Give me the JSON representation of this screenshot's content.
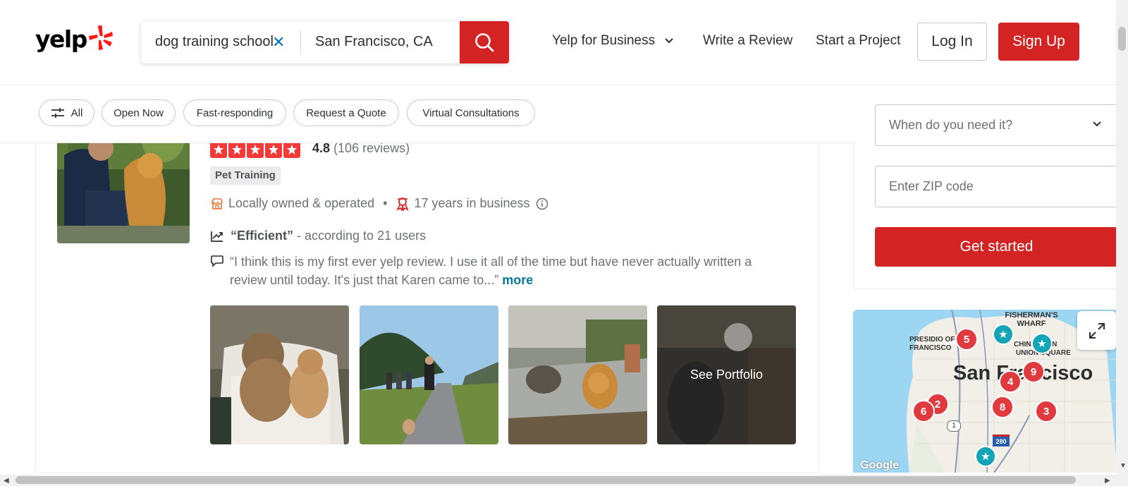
{
  "brand": {
    "logo_text": "yelp",
    "accent": "#d32323"
  },
  "search": {
    "what_value": "dog training school",
    "where_value": "San Francisco, CA",
    "clear_icon": "close-icon",
    "search_icon": "search-icon"
  },
  "nav": {
    "for_business": "Yelp for Business",
    "write_review": "Write a Review",
    "start_project": "Start a Project",
    "login": "Log In",
    "signup": "Sign Up"
  },
  "filters": [
    "All",
    "Open Now",
    "Fast-responding",
    "Request a Quote",
    "Virtual Consultations"
  ],
  "listing": {
    "rating_value": "4.8",
    "review_count": "(106 reviews)",
    "stars": 5,
    "category": "Pet Training",
    "attr_local": "Locally owned & operated",
    "attr_bullet": "•",
    "attr_years": "17 years in business",
    "highlight_quote": "“Efficient”",
    "highlight_suffix": " - according to 21 users",
    "review_snippet": "“I think this is my first ever yelp review. I use it all of the time but have never actually written a review until today. It's just that Karen came to...”",
    "more_label": "more",
    "see_portfolio": "See Portfolio"
  },
  "sidebar": {
    "when_placeholder": "When do you need it?",
    "zip_placeholder": "Enter ZIP code",
    "cta_label": "Get started"
  },
  "map": {
    "city_label": "San Francisco",
    "labels": [
      "FISHERMAN'S WHARF",
      "PRESIDIO OF SAN FRANCISCO",
      "CHINATOWN",
      "UNION SQUARE"
    ],
    "markers": [
      "5",
      "9",
      "4",
      "2",
      "6",
      "8",
      "3"
    ],
    "road_shield": "1",
    "interstate": "280",
    "attribution": "Google"
  }
}
